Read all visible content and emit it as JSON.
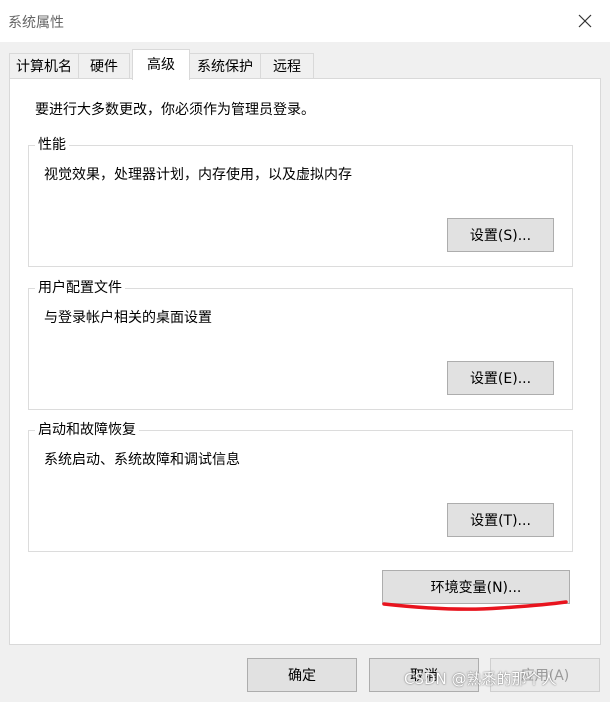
{
  "window": {
    "title": "系统属性",
    "close_icon": "close-icon"
  },
  "tabs": [
    {
      "label": "计算机名"
    },
    {
      "label": "硬件"
    },
    {
      "label": "高级",
      "active": true
    },
    {
      "label": "系统保护"
    },
    {
      "label": "远程"
    }
  ],
  "notice": "要进行大多数更改，你必须作为管理员登录。",
  "groups": {
    "performance": {
      "title": "性能",
      "desc": "视觉效果，处理器计划，内存使用，以及虚拟内存",
      "button": "设置(S)..."
    },
    "user_profiles": {
      "title": "用户配置文件",
      "desc": "与登录帐户相关的桌面设置",
      "button": "设置(E)..."
    },
    "startup_recovery": {
      "title": "启动和故障恢复",
      "desc": "系统启动、系统故障和调试信息",
      "button": "设置(T)..."
    }
  },
  "env_button": "环境变量(N)...",
  "annotation_color": "#e8141e",
  "footer": {
    "ok": "确定",
    "cancel": "取消",
    "apply": "应用(A)"
  },
  "watermark": "CSDN @熟悉的那个人"
}
